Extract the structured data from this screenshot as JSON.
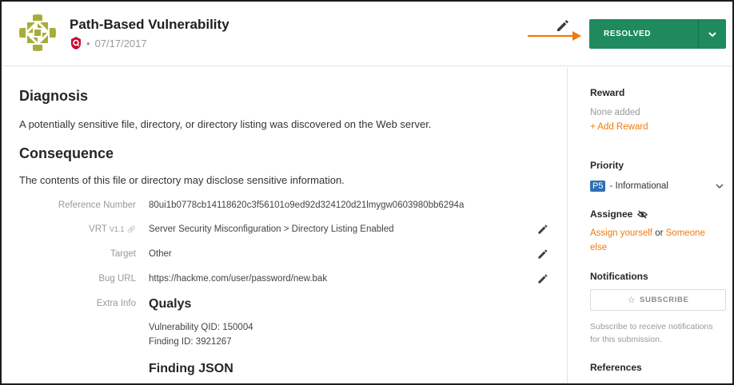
{
  "header": {
    "title": "Path-Based Vulnerability",
    "date": "07/17/2017",
    "separator": "•",
    "status_button": "RESOLVED"
  },
  "main": {
    "diagnosis_heading": "Diagnosis",
    "diagnosis_text": "A potentially sensitive file, directory, or directory listing was discovered on the Web server.",
    "consequence_heading": "Consequence",
    "consequence_text": "The contents of this file or directory may disclose sensitive information.",
    "fields": {
      "reference_label": "Reference Number",
      "reference_value": "80ui1b0778cb14118620c3f56101o9ed92d324120d21lmygw0603980bb6294a",
      "vrt_label": "VRT",
      "vrt_version": "V1.1",
      "vrt_value": "Server Security Misconfiguration > Directory Listing Enabled",
      "target_label": "Target",
      "target_value": "Other",
      "bug_url_label": "Bug URL",
      "bug_url_value": "https://hackme.com/user/password/new.bak",
      "extra_info_label": "Extra Info"
    },
    "extra": {
      "qualys_heading": "Qualys",
      "qid": "Vulnerability QID: 150004",
      "finding_id": "Finding ID: 3921267",
      "json_heading": "Finding JSON"
    }
  },
  "sidebar": {
    "reward_heading": "Reward",
    "reward_none": "None added",
    "add_reward": "+ Add Reward",
    "priority_heading": "Priority",
    "priority_badge": "P5",
    "priority_text": "- Informational",
    "assignee_heading": "Assignee",
    "assign_yourself": "Assign yourself",
    "assign_or": "or",
    "assign_someone": "Someone",
    "assign_else": "else",
    "notifications_heading": "Notifications",
    "subscribe_label": "SUBSCRIBE",
    "subscribe_help_1": "Subscribe to receive notifications",
    "subscribe_help_2": "for this submission.",
    "references_heading": "References"
  },
  "colors": {
    "resolved_green": "#1f8a5e",
    "accent_orange": "#f07a0d",
    "priority_blue": "#2f6fb5"
  },
  "icons": {
    "avatar": "identicon-avatar",
    "program_badge": "qualys-badge-icon",
    "edit": "pencil-icon",
    "arrow": "arrow-right-icon",
    "caret": "chevron-down-icon",
    "visibility": "eye-off-icon",
    "star": "star-icon",
    "link": "link-icon"
  }
}
